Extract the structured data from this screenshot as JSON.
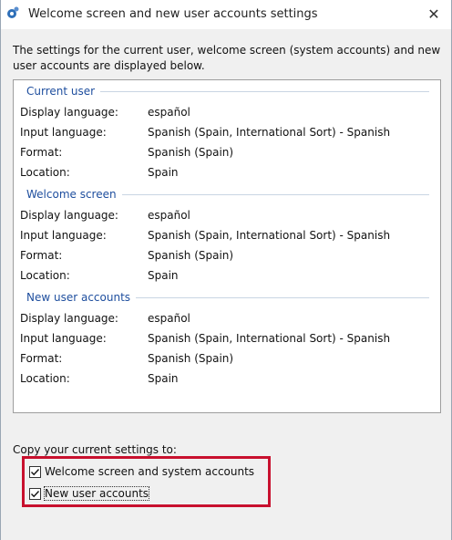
{
  "window": {
    "title": "Welcome screen and new user accounts settings",
    "close_glyph": "✕"
  },
  "intro_text": "The settings for the current user, welcome screen (system accounts) and new user accounts are displayed below.",
  "sections": [
    {
      "title": "Current user",
      "rows": [
        {
          "label": "Display language:",
          "value": "español"
        },
        {
          "label": "Input language:",
          "value": "Spanish (Spain, International Sort) - Spanish"
        },
        {
          "label": "Format:",
          "value": "Spanish (Spain)"
        },
        {
          "label": "Location:",
          "value": "Spain"
        }
      ]
    },
    {
      "title": "Welcome screen",
      "rows": [
        {
          "label": "Display language:",
          "value": "español"
        },
        {
          "label": "Input language:",
          "value": "Spanish (Spain, International Sort) - Spanish"
        },
        {
          "label": "Format:",
          "value": "Spanish (Spain)"
        },
        {
          "label": "Location:",
          "value": "Spain"
        }
      ]
    },
    {
      "title": "New user accounts",
      "rows": [
        {
          "label": "Display language:",
          "value": "español"
        },
        {
          "label": "Input language:",
          "value": "Spanish (Spain, International Sort) - Spanish"
        },
        {
          "label": "Format:",
          "value": "Spanish (Spain)"
        },
        {
          "label": "Location:",
          "value": "Spain"
        }
      ]
    }
  ],
  "copy": {
    "label": "Copy your current settings to:",
    "options": [
      {
        "label": "Welcome screen and system accounts",
        "checked": true
      },
      {
        "label": "New user accounts",
        "checked": true
      }
    ]
  },
  "colors": {
    "section_title": "#1e4e9e",
    "highlight": "#c8102e"
  }
}
